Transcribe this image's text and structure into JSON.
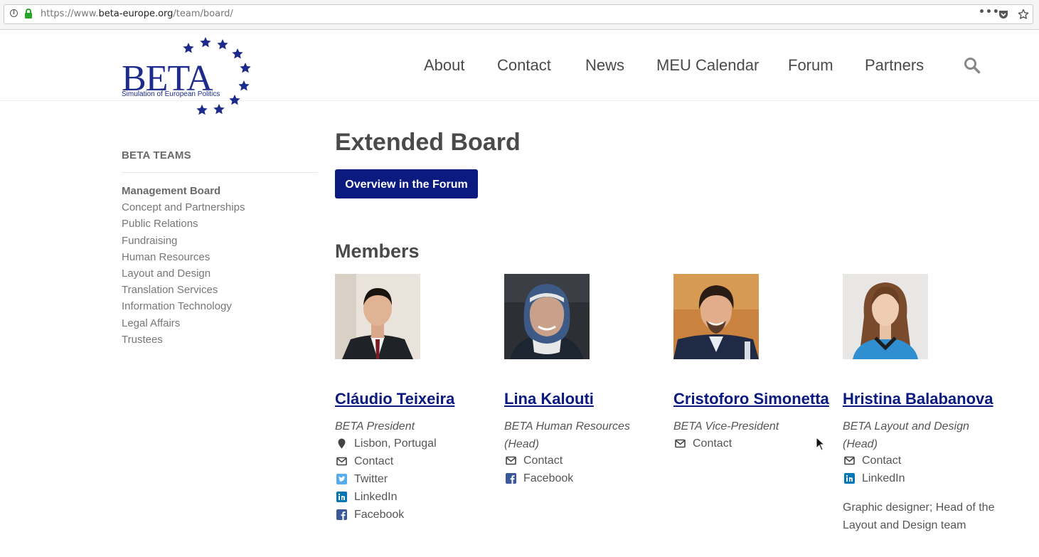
{
  "browser": {
    "url_prefix": "https://www.",
    "url_domain": "beta-europe.org",
    "url_path": "/team/board/",
    "more_label": "•••"
  },
  "site": {
    "logo_text": "BETA",
    "logo_tagline": "Simulation of European Politics",
    "nav": [
      "About",
      "Contact",
      "News",
      "MEU Calendar",
      "Forum",
      "Partners"
    ]
  },
  "sidebar": {
    "heading": "BETA TEAMS",
    "items": [
      "Management Board",
      "Concept and Partnerships",
      "Public Relations",
      "Fundraising",
      "Human Resources",
      "Layout and Design",
      "Translation Services",
      "Information Technology",
      "Legal Affairs",
      "Trustees"
    ],
    "active_item": "Management Board"
  },
  "main": {
    "title": "Extended Board",
    "forum_button": "Overview in the Forum",
    "members_heading": "Members",
    "members": [
      {
        "name": "Cláudio Teixeira",
        "role": "BETA President",
        "links": [
          {
            "icon": "location-pin-icon",
            "label": "Lisbon, Portugal"
          },
          {
            "icon": "envelope-icon",
            "label": "Contact"
          },
          {
            "icon": "twitter-icon",
            "label": "Twitter"
          },
          {
            "icon": "linkedin-icon",
            "label": "LinkedIn"
          },
          {
            "icon": "facebook-icon",
            "label": "Facebook"
          }
        ],
        "bio": ""
      },
      {
        "name": "Lina Kalouti",
        "role": "BETA Human Resources (Head)",
        "links": [
          {
            "icon": "envelope-icon",
            "label": "Contact"
          },
          {
            "icon": "facebook-icon",
            "label": "Facebook"
          }
        ],
        "bio": ""
      },
      {
        "name": "Cristoforo Simonetta",
        "role": "BETA Vice-President",
        "links": [
          {
            "icon": "envelope-icon",
            "label": "Contact"
          }
        ],
        "bio": ""
      },
      {
        "name": "Hristina Balabanova",
        "role": "BETA Layout and Design (Head)",
        "links": [
          {
            "icon": "envelope-icon",
            "label": "Contact"
          },
          {
            "icon": "linkedin-icon",
            "label": "LinkedIn"
          }
        ],
        "bio": "Graphic designer; Head of the Layout and Design team"
      }
    ]
  },
  "colors": {
    "brand_navy": "#0a1a7e",
    "twitter_blue": "#55acee",
    "linkedin_blue": "#0077b5",
    "facebook_blue": "#3b5998"
  }
}
